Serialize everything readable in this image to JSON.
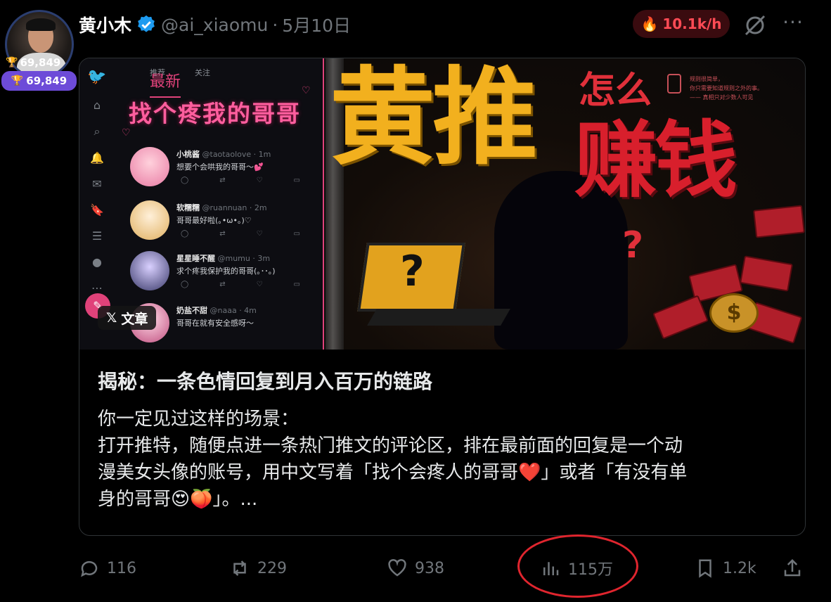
{
  "author": {
    "name": "黄小木",
    "handle": "@ai_xiaomu",
    "separator": "·",
    "date": "5月10日",
    "verified": true,
    "trophy_score_1": "69,849",
    "trophy_score_2": "69,849"
  },
  "header": {
    "hot_rate": "10.1k/h",
    "hot_icon": "fire-icon",
    "more_icon": "more-icon"
  },
  "cover": {
    "mock_tabs": [
      "推荐",
      "最新",
      "关注"
    ],
    "mock_title": "找个疼我的哥哥",
    "mock_posts": [
      {
        "name": "小桃酱",
        "handle": "@taotaolove · 1m",
        "text": "想要个会哄我的哥哥～💕"
      },
      {
        "name": "软糯糯",
        "handle": "@ruannuan · 2m",
        "text": "哥哥最好啦(｡•ω•｡)♡"
      },
      {
        "name": "星星睡不醒",
        "handle": "@mumu · 3m",
        "text": "求个疼我保护我的哥哥(｡･･｡)"
      },
      {
        "name": "奶盐不甜",
        "handle": "@naaa · 4m",
        "text": "哥哥在就有安全感呀～"
      }
    ],
    "article_tag_icon": "𝕏",
    "article_tag": "文章",
    "headline_1": "黄推",
    "headline_2": "怎么",
    "headline_3": "赚钱",
    "headline_q": "?",
    "note": "规则很简单，\n你只需要知道规则之外的事。\n—— 真相只对少数人可见",
    "laptop_q": "?",
    "coin_symbol": "$"
  },
  "article": {
    "title": "揭秘：一条色情回复到月入百万的链路",
    "lines": [
      "你一定见过这样的场景：",
      "打开推特，随便点进一条热门推文的评论区，排在最前面的回复是一个动",
      "漫美女头像的账号，用中文写着「找个会疼人的哥哥❤️」或者「有没有单",
      "身的哥哥😍🍑」。..."
    ]
  },
  "actions": {
    "replies": "116",
    "reposts": "229",
    "likes": "938",
    "views": "115万",
    "bookmarks": "1.2k"
  },
  "colors": {
    "background": "#000000",
    "muted": "#71767b",
    "accent_pink": "#e0427a",
    "headline_gold": "#f2b01e",
    "headline_red": "#d81f2c",
    "hot_red": "#ff4b55",
    "annotation_red": "#e0252e",
    "badge_purple": "#6d4bd8"
  }
}
